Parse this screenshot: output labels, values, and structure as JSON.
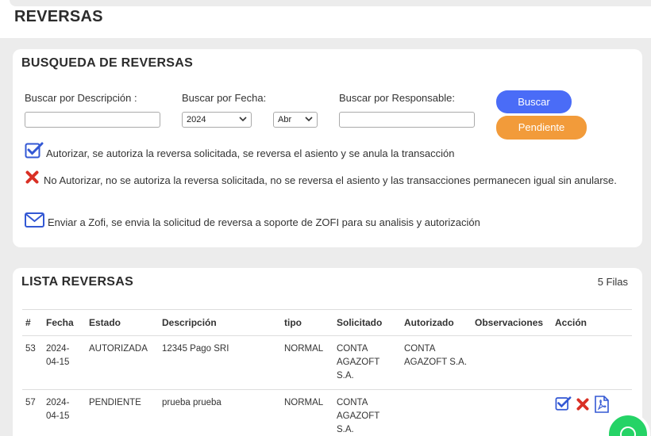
{
  "page": {
    "title": "REVERSAS"
  },
  "search": {
    "title": "BUSQUEDA DE REVERSAS",
    "desc_label": "Buscar por Descripción :",
    "desc_value": "",
    "date_label": "Buscar por Fecha:",
    "year_value": "2024",
    "month_value": "Abr",
    "resp_label": "Buscar por Responsable:",
    "resp_value": "",
    "buscar_label": "Buscar",
    "pendiente_label": "Pendiente"
  },
  "legend": [
    {
      "icon": "check-square-icon",
      "text": "Autorizar, se autoriza la reversa solicitada, se reversa el asiento y se anula la transacción"
    },
    {
      "icon": "x-icon",
      "text": "No Autorizar, no se autoriza la reversa solicitada, no se reversa el asiento y las transacciones permanecen igual sin anularse."
    },
    {
      "icon": "envelope-icon",
      "text": "Enviar a Zofi, se envia la solicitud de reversa a soporte de ZOFI para su analisis y autorización"
    }
  ],
  "list": {
    "title": "LISTA REVERSAS",
    "count": "5 Filas",
    "columns": [
      "#",
      "Fecha",
      "Estado",
      "Descripción",
      "tipo",
      "Solicitado",
      "Autorizado",
      "Observaciones",
      "Acción"
    ],
    "rows": [
      {
        "id": "53",
        "fecha": "2024-04-15",
        "estado": "AUTORIZADA",
        "descripcion": "12345 Pago SRI",
        "tipo": "NORMAL",
        "solicitado": "CONTA AGAZOFT S.A.",
        "autorizado": "CONTA AGAZOFT S.A.",
        "observaciones": ""
      },
      {
        "id": "57",
        "fecha": "2024-04-15",
        "estado": "PENDIENTE",
        "descripcion": "prueba prueba",
        "tipo": "NORMAL",
        "solicitado": "CONTA AGAZOFT S.A.",
        "autorizado": "",
        "observaciones": ""
      }
    ]
  },
  "colors": {
    "primary": "#4a6cf7",
    "pending": "#f29b3a",
    "danger": "#d93025",
    "whatsapp": "#25d366"
  }
}
